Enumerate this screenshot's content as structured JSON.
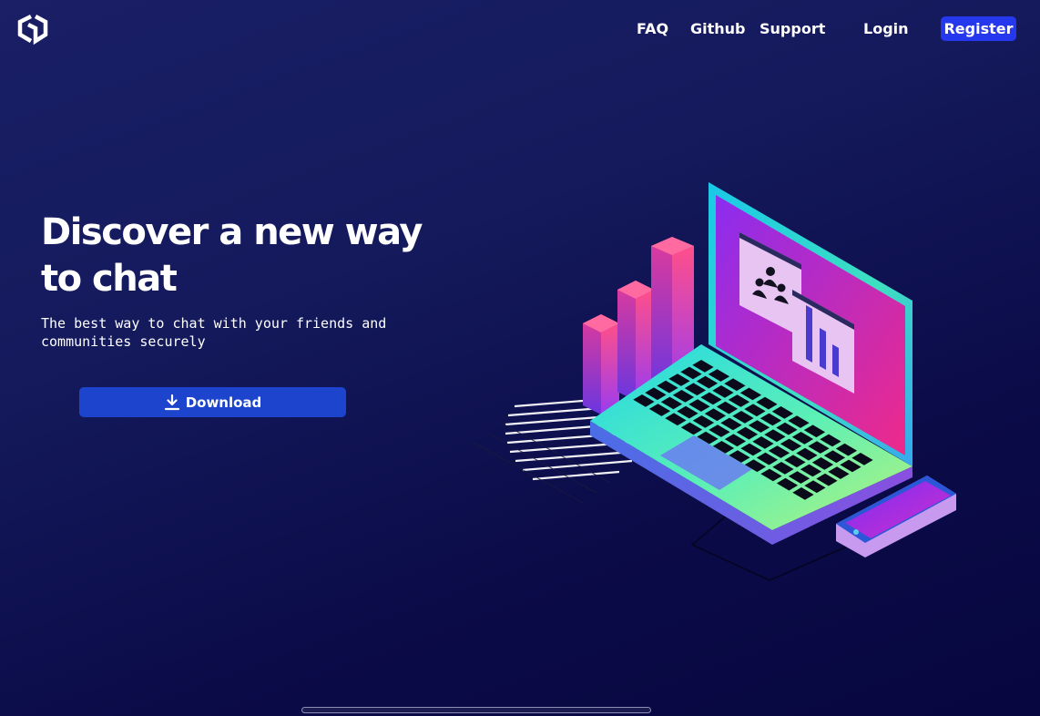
{
  "header": {
    "logo_icon": "hexagon-logo-icon",
    "nav": {
      "faq": "FAQ",
      "github": "Github",
      "support": "Support",
      "login": "Login",
      "register": "Register"
    }
  },
  "hero": {
    "title": "Discover a new way to chat",
    "subtitle": "The best way to chat with your friends and communities securely",
    "download_label": "Download",
    "download_icon": "download-icon",
    "illustration": "laptop-phone-chart-illustration"
  },
  "colors": {
    "background": "#141a5c",
    "register_button": "#2638ee",
    "download_button": "#1c44cc"
  }
}
